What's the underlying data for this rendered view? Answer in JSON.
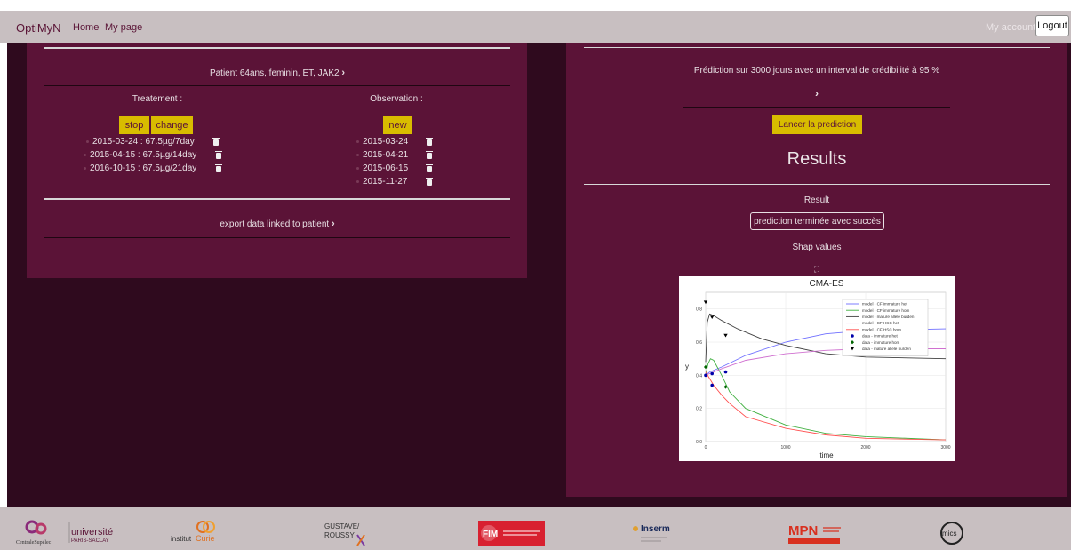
{
  "navbar": {
    "brand": "OptiMyN",
    "home": "Home",
    "mypage": "My page",
    "myaccount": "My account",
    "logout": "Logout"
  },
  "left_panel": {
    "patient_header": "Patient 64ans, feminin, ET, JAK2",
    "treatment_title": "Treatement :",
    "observation_title": "Observation :",
    "stop_label": "stop",
    "change_label": "change",
    "new_label": "new",
    "treatments": [
      "2015-03-24 : 67.5µg/7day",
      "2015-04-15 : 67.5µg/14day",
      "2016-10-15 : 67.5µg/21day"
    ],
    "observations": [
      "2015-03-24",
      "2015-04-21",
      "2015-06-15",
      "2015-11-27"
    ],
    "export_label": "export data linked to patient"
  },
  "right_panel": {
    "prediction_text": "Prédiction sur 3000 jours avec un interval de crédibilité à 95 %",
    "launch_label": "Lancer la prediction",
    "results_title": "Results",
    "result_label": "Result",
    "result_status": "prediction terminée avec succès",
    "shap_label": "Shap values",
    "expand_icon": "expand-icon"
  },
  "colors": {
    "accent_yellow": "#d8bc00",
    "panel": "#5b1337",
    "background": "#2f0a1e",
    "navbar": "#c8bfc1"
  },
  "chart_data": {
    "type": "line",
    "title": "CMA-ES",
    "xlabel": "time",
    "ylabel": "y",
    "xlim": [
      0,
      3000
    ],
    "ylim": [
      0,
      0.9
    ],
    "xticks": [
      0,
      1000,
      2000,
      3000
    ],
    "yticks": [
      0.0,
      0.2,
      0.4,
      0.6,
      0.8
    ],
    "tick_labels_x": [
      "0",
      "1000",
      "2000",
      "3000"
    ],
    "tick_labels_y": [
      "0.0",
      "0.2",
      "0.4",
      "0.6",
      "0.8"
    ],
    "legend_position": "top-right",
    "series": [
      {
        "name": "model - CF immature het",
        "color": "#7070ff",
        "x": [
          0,
          50,
          200,
          500,
          1000,
          1500,
          2000,
          3000
        ],
        "y": [
          0.4,
          0.42,
          0.45,
          0.52,
          0.6,
          0.65,
          0.67,
          0.68
        ]
      },
      {
        "name": "model - CF immature hom",
        "color": "#40b040",
        "x": [
          0,
          30,
          60,
          100,
          200,
          300,
          500,
          1000,
          1500,
          2000,
          3000
        ],
        "y": [
          0.4,
          0.47,
          0.5,
          0.49,
          0.4,
          0.3,
          0.2,
          0.1,
          0.05,
          0.03,
          0.01
        ]
      },
      {
        "name": "model - mature allele burden",
        "color": "#404040",
        "x": [
          0,
          20,
          50,
          100,
          200,
          400,
          700,
          1000,
          1500,
          2000,
          3000
        ],
        "y": [
          0.48,
          0.72,
          0.77,
          0.76,
          0.73,
          0.68,
          0.62,
          0.58,
          0.53,
          0.51,
          0.5
        ]
      },
      {
        "name": "model - CF HSC het",
        "color": "#d070d0",
        "x": [
          0,
          200,
          500,
          1000,
          1500,
          2000,
          3000
        ],
        "y": [
          0.4,
          0.44,
          0.49,
          0.53,
          0.55,
          0.56,
          0.56
        ]
      },
      {
        "name": "model - CF HSC hom",
        "color": "#ff5050",
        "x": [
          0,
          50,
          100,
          200,
          300,
          500,
          1000,
          1500,
          2000,
          3000
        ],
        "y": [
          0.42,
          0.38,
          0.34,
          0.28,
          0.23,
          0.15,
          0.08,
          0.04,
          0.02,
          0.01
        ]
      }
    ],
    "points": [
      {
        "name": "data - immature het",
        "marker": "circle",
        "color": "#0000aa",
        "x": [
          0,
          80,
          250
        ],
        "y": [
          0.4,
          0.41,
          0.42
        ]
      },
      {
        "name": "data - immature hom",
        "marker": "diamond",
        "color": "#006400",
        "x": [
          0,
          250
        ],
        "y": [
          0.45,
          0.33
        ]
      },
      {
        "name": "data - mature allele burden",
        "marker": "triangle",
        "color": "#000000",
        "x": [
          0,
          80,
          250
        ],
        "y": [
          0.84,
          0.75,
          0.64
        ]
      },
      {
        "name": "data - CF HSC",
        "marker": "circle",
        "color": "#0000aa",
        "x": [
          80
        ],
        "y": [
          0.34
        ]
      }
    ]
  },
  "footer_logos": [
    "CentraleSupélec",
    "université PARIS-SACLAY",
    "institutCurie",
    "GUSTAVE ROUSSY",
    "FIM",
    "Inserm",
    "MPN RESEARCH FOUNDATION",
    "mics"
  ]
}
